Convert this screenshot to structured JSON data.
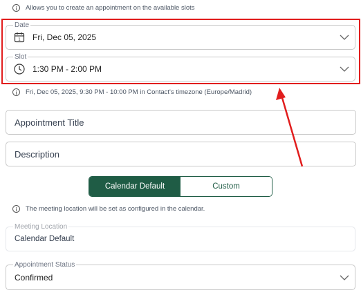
{
  "top_info": {
    "text": "Allows you to create an appointment on the available slots"
  },
  "date_field": {
    "label": "Date",
    "value": "Fri, Dec 05, 2025",
    "icon": "calendar-icon"
  },
  "slot_field": {
    "label": "Slot",
    "value": "1:30 PM - 2:00 PM",
    "icon": "clock-icon"
  },
  "timezone_info": {
    "text": "Fri, Dec 05, 2025, 9:30 PM - 10:00 PM in Contact's timezone (Europe/Madrid)"
  },
  "title_input": {
    "placeholder": "Appointment Title"
  },
  "description_input": {
    "placeholder": "Description"
  },
  "location_toggle": {
    "options": [
      "Calendar Default",
      "Custom"
    ],
    "selected": "Calendar Default",
    "active_color": "#1f5c45"
  },
  "location_info": {
    "text": "The meeting location will be set as configured in the calendar."
  },
  "meeting_location": {
    "label": "Meeting Location",
    "value": "Calendar Default"
  },
  "appointment_status": {
    "label": "Appointment Status",
    "value": "Confirmed"
  },
  "annotation": {
    "highlight_color": "#e11d1d"
  }
}
